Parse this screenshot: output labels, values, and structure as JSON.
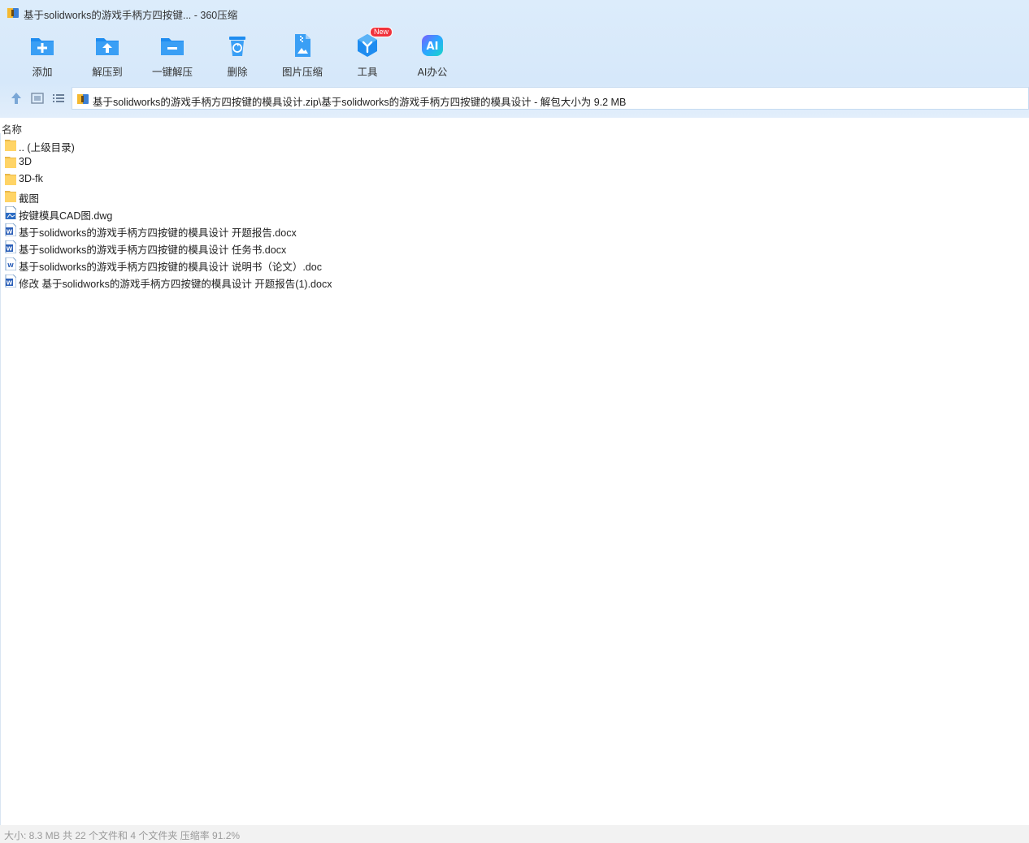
{
  "window": {
    "title": "基于solidworks的游戏手柄方四按键... - 360压缩"
  },
  "toolbar": {
    "buttons": [
      {
        "label": "添加",
        "icon": "add-folder-icon"
      },
      {
        "label": "解压到",
        "icon": "extract-to-icon"
      },
      {
        "label": "一键解压",
        "icon": "one-click-extract-icon"
      },
      {
        "label": "删除",
        "icon": "trash-icon"
      },
      {
        "label": "图片压缩",
        "icon": "image-compress-icon"
      },
      {
        "label": "工具",
        "icon": "tools-icon",
        "badge": "New"
      },
      {
        "label": "AI办公",
        "icon": "ai-office-icon"
      }
    ]
  },
  "address": {
    "path": "基于solidworks的游戏手柄方四按键的模具设计.zip\\基于solidworks的游戏手柄方四按键的模具设计 - 解包大小为 9.2 MB"
  },
  "columns": {
    "name": "名称"
  },
  "files": [
    {
      "name": ".. (上级目录)",
      "type": "folder"
    },
    {
      "name": "3D",
      "type": "folder"
    },
    {
      "name": "3D-fk",
      "type": "folder"
    },
    {
      "name": "截图",
      "type": "folder"
    },
    {
      "name": "按键模具CAD图.dwg",
      "type": "dwg"
    },
    {
      "name": "基于solidworks的游戏手柄方四按键的模具设计 开题报告.docx",
      "type": "word"
    },
    {
      "name": "基于solidworks的游戏手柄方四按键的模具设计 任务书.docx",
      "type": "word"
    },
    {
      "name": "基于solidworks的游戏手柄方四按键的模具设计 说明书（论文）.doc",
      "type": "word-old"
    },
    {
      "name": "修改 基于solidworks的游戏手柄方四按键的模具设计 开题报告(1).docx",
      "type": "word"
    }
  ],
  "status": {
    "text": "大小: 8.3 MB 共 22 个文件和 4 个文件夹 压缩率 91.2%"
  },
  "colors": {
    "toolbar_bg": "#dcecfb",
    "icon_blue": "#1e8cf0",
    "folder_yellow": "#ffd466",
    "badge_red": "#f0323c"
  }
}
